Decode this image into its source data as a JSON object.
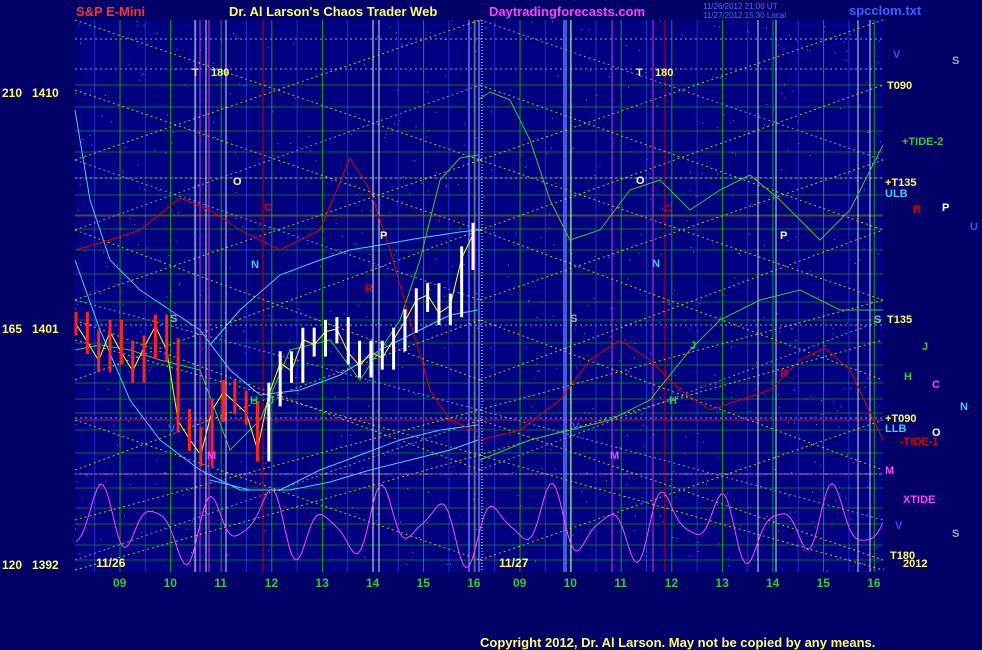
{
  "header": {
    "symbol": "S&P E-Mini",
    "title": "Dr. Al Larson's Chaos Trader Web",
    "site": "Daytradingforecasts.com",
    "stamp1": "11/26/2012 21:00 UT",
    "stamp2": "11/27/2012 15:30 Local",
    "file": "spcclom.txt"
  },
  "footer": {
    "copyright": "Copyright 2012, Dr. Al Larson. May not be copied by any means."
  },
  "colors": {
    "background": "#000066",
    "plot_bg": "#000080",
    "grid_green": "#00cc00",
    "grid_blue": "#3355ff",
    "price_red": "#ff2222",
    "price_white": "#ffffff",
    "ma_cyan": "#44ccff",
    "ma_green": "#33cc33",
    "red_line": "#dd0000",
    "magenta": "#ff44ff",
    "yellow_dotted": "#dddd00",
    "gray_dotted": "#aaaaaa"
  },
  "chart_data": {
    "type": "line",
    "y_axis_labels": [
      {
        "wave": "210",
        "price": "1410"
      },
      {
        "wave": "165",
        "price": "1401"
      },
      {
        "wave": "120",
        "price": "1392"
      }
    ],
    "ylim_price": [
      1392,
      1410
    ],
    "x_date_labels": [
      "11/26",
      "11/27"
    ],
    "x_hour_labels": [
      "09",
      "10",
      "11",
      "12",
      "13",
      "14",
      "15",
      "16",
      "09",
      "10",
      "11",
      "12",
      "13",
      "14",
      "15",
      "16"
    ],
    "right_labels": [
      {
        "text": "V",
        "color": "#3355ff"
      },
      {
        "text": "S",
        "color": "#aaaaaa"
      },
      {
        "text": "T090",
        "color": "#ffff66"
      },
      {
        "text": "+TIDE-2",
        "color": "#33cc33"
      },
      {
        "text": "+T135",
        "color": "#ffff66"
      },
      {
        "text": "ULB",
        "color": "#44ccff"
      },
      {
        "text": "R",
        "color": "#dd0000"
      },
      {
        "text": "P",
        "color": "#ffffff"
      },
      {
        "text": "U",
        "color": "#3355ff"
      },
      {
        "text": "S",
        "color": "#aaaaaa"
      },
      {
        "text": "T135",
        "color": "#ffff66"
      },
      {
        "text": "J",
        "color": "#33cc33"
      },
      {
        "text": "H",
        "color": "#33cc33"
      },
      {
        "text": "C",
        "color": "#ff44ff"
      },
      {
        "text": "N",
        "color": "#44ccff"
      },
      {
        "text": "+T090",
        "color": "#ffff66"
      },
      {
        "text": "LLB",
        "color": "#44ccff"
      },
      {
        "text": "O",
        "color": "#ffffff"
      },
      {
        "text": "-TIDE-1",
        "color": "#dd0000"
      },
      {
        "text": "M",
        "color": "#ff44ff"
      },
      {
        "text": "XTIDE",
        "color": "#ff44ff"
      },
      {
        "text": "V",
        "color": "#3355ff"
      },
      {
        "text": "S",
        "color": "#aaaaaa"
      },
      {
        "text": "T180",
        "color": "#ffff66"
      },
      {
        "text": "2012",
        "color": "#ffff66"
      }
    ],
    "in_chart_labels": [
      {
        "text": "T",
        "color": "#ffff66"
      },
      {
        "text": "180",
        "color": "#ffff66"
      },
      {
        "text": "O",
        "color": "#ffffff"
      },
      {
        "text": "C",
        "color": "#dd0000"
      },
      {
        "text": "N",
        "color": "#44ccff"
      },
      {
        "text": "P",
        "color": "#ffffff"
      },
      {
        "text": "S",
        "color": "#aaaaaa"
      },
      {
        "text": "V",
        "color": "#3355ff"
      },
      {
        "text": "M",
        "color": "#ff44ff"
      },
      {
        "text": "J",
        "color": "#33cc33"
      },
      {
        "text": "H",
        "color": "#33cc33"
      },
      {
        "text": "R",
        "color": "#dd0000"
      }
    ],
    "series": [
      {
        "values": [
          1401.2,
          1400.5,
          1399.8,
          1400.9,
          1400.1,
          1399.4,
          1400.3,
          1401.1,
          1400.2,
          1397.5,
          1396.8,
          1396.2,
          1397.9,
          1398.6,
          1398.2,
          1397.8,
          1396.4,
          1398.5,
          1399.7,
          1399.4,
          1400.6,
          1400.4,
          1400.9,
          1401.0,
          1400.1,
          1399.6,
          1400.1,
          1399.9,
          1400.6,
          1401.3,
          1402.1,
          1402.3,
          1401.6,
          1401.9,
          1403.7,
          1404.6
        ]
      }
    ]
  }
}
